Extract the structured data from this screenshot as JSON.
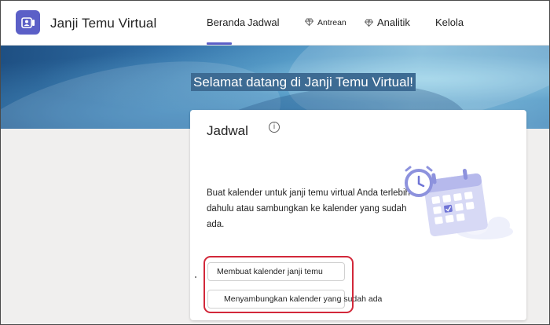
{
  "app": {
    "title": "Janji Temu Virtual"
  },
  "nav": {
    "tabs": [
      {
        "label": "Beranda",
        "active": true
      },
      {
        "label": "Jadwal"
      },
      {
        "label": "Antrean",
        "premium": true
      },
      {
        "label": "Analitik",
        "premium": true
      },
      {
        "label": "Kelola"
      }
    ]
  },
  "banner": {
    "welcome": "Selamat datang di Janji Temu Virtual!"
  },
  "card": {
    "title": "Jadwal",
    "info_icon": "i",
    "description": "Buat kalender untuk janji temu virtual Anda terlebih dahulu atau sambungkan ke kalender yang sudah ada.",
    "buttons": {
      "create_calendar": "Membuat kalender janji temu",
      "connect_calendar": "Menyambungkan kalender yang sudah ada"
    }
  },
  "colors": {
    "brand": "#5b5fc7",
    "highlight": "#d2283a",
    "banner": "#2f6ea6"
  },
  "icons": {
    "app": "people-icon",
    "premium": "diamond-icon",
    "info": "info-icon",
    "illustration": "calendar-clock-illustration"
  }
}
